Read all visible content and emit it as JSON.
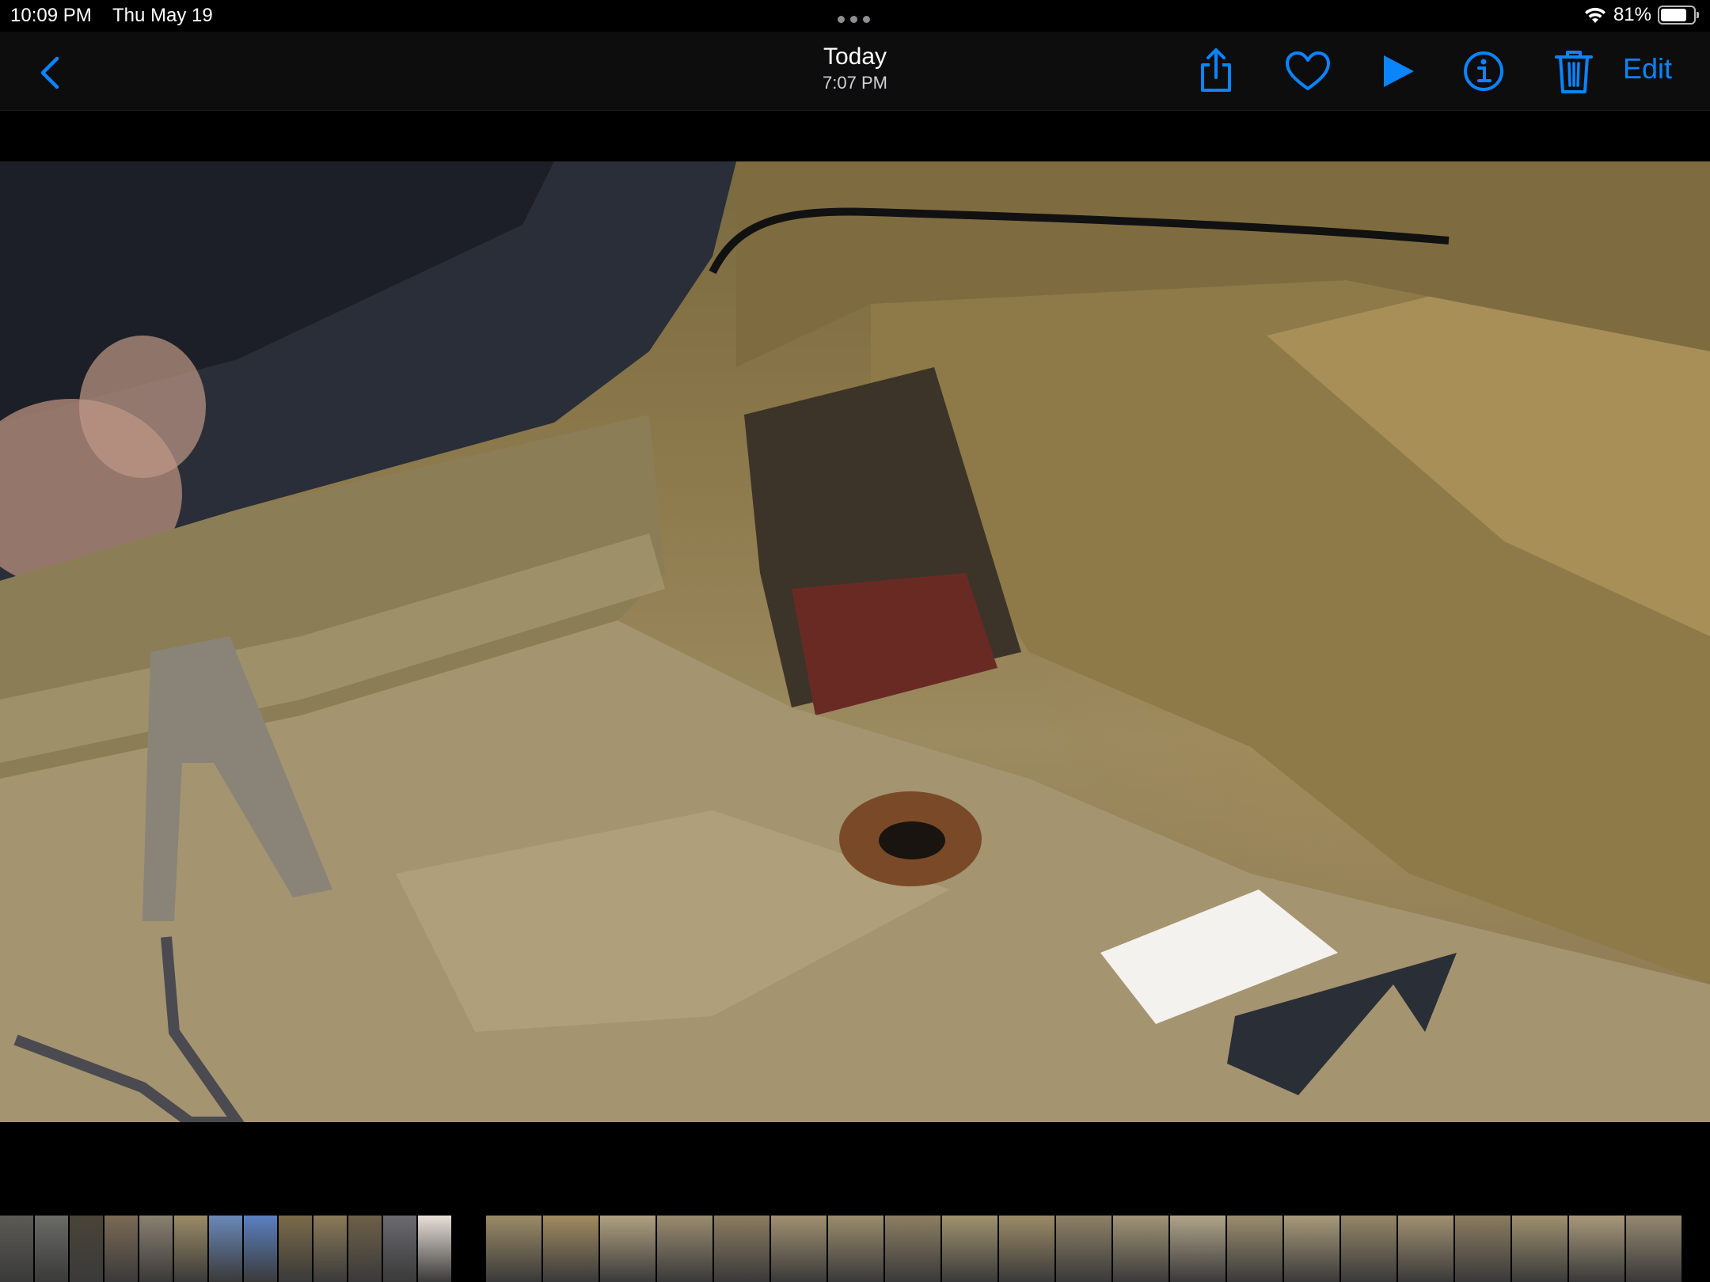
{
  "status_bar": {
    "time": "10:09 PM",
    "date": "Thu May 19",
    "battery_text": "81%",
    "battery_level": 0.81,
    "icons": [
      "multitask-dots-icon",
      "wifi-icon",
      "battery-icon"
    ]
  },
  "nav": {
    "title": "Today",
    "subtitle": "7:07 PM",
    "edit_label": "Edit",
    "accent_color": "#0a84ff",
    "icons": [
      "chevron-left-icon",
      "share-icon",
      "heart-icon",
      "play-icon",
      "info-icon",
      "trash-icon"
    ]
  },
  "photo": {
    "description_icon": "photo-image"
  },
  "filmstrip": {
    "thumbnails": [
      {
        "color": "#5b5a55"
      },
      {
        "color": "#6a6a66"
      },
      {
        "color": "#4a4438"
      },
      {
        "color": "#7b6a55"
      },
      {
        "color": "#8a8070"
      },
      {
        "color": "#9a8a66"
      },
      {
        "color": "#6a88b8"
      },
      {
        "color": "#5a80c0"
      },
      {
        "color": "#7a6a48"
      },
      {
        "color": "#8a7a58"
      },
      {
        "color": "#6e6048"
      },
      {
        "color": "#6a6a70"
      },
      {
        "color": "#e8e0d8"
      },
      {
        "color": "#000000"
      },
      {
        "color": "#9a8a66"
      },
      {
        "color": "#a08a60"
      },
      {
        "color": "#b0a080"
      },
      {
        "color": "#9a8c70"
      },
      {
        "color": "#8a7c60"
      },
      {
        "color": "#a09070"
      },
      {
        "color": "#9a8c6c"
      },
      {
        "color": "#8c7e62"
      },
      {
        "color": "#a0926e"
      },
      {
        "color": "#9a8a66"
      },
      {
        "color": "#8e8066"
      },
      {
        "color": "#a09476"
      },
      {
        "color": "#b0a48a"
      },
      {
        "color": "#9a8c6e"
      },
      {
        "color": "#a89a7a"
      },
      {
        "color": "#948668"
      },
      {
        "color": "#a09070"
      },
      {
        "color": "#8a7c60"
      },
      {
        "color": "#9e906e"
      },
      {
        "color": "#a8987a"
      },
      {
        "color": "#948870"
      }
    ]
  }
}
